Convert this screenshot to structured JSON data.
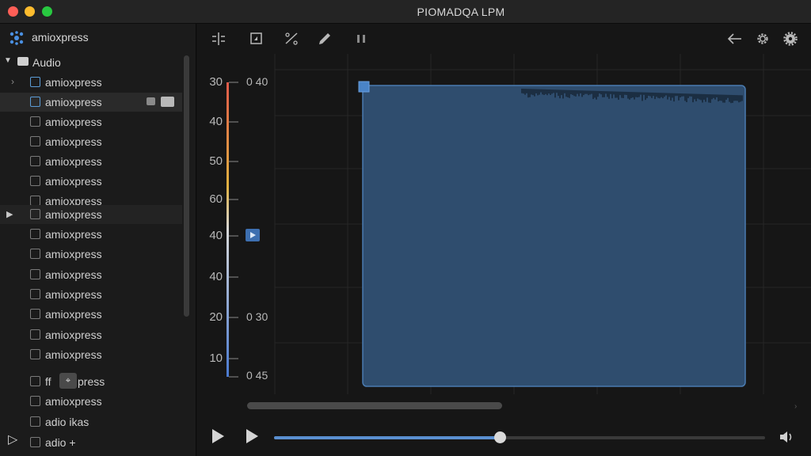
{
  "window": {
    "title": "PIOMADQA LPM"
  },
  "sidebar": {
    "app_name": "amioxpress",
    "group_label": "Audio",
    "items": [
      {
        "label": "amioxpress",
        "state": "expand"
      },
      {
        "label": "amioxpress",
        "state": "selected"
      },
      {
        "label": "amioxpress"
      },
      {
        "label": "amioxpress"
      },
      {
        "label": "amioxpress"
      },
      {
        "label": "amioxpress"
      },
      {
        "label": "amioxpress"
      },
      {
        "label": "amioxpress",
        "state": "playing"
      },
      {
        "label": "amioxpress"
      },
      {
        "label": "amioxpress"
      },
      {
        "label": "amioxpress"
      },
      {
        "label": "amioxpress"
      },
      {
        "label": "amioxpress"
      },
      {
        "label": "amioxpress"
      },
      {
        "label": "amioxpress"
      },
      {
        "label": "ff",
        "suffix": "press"
      },
      {
        "label": "amioxpress"
      },
      {
        "label": "adio ikas"
      },
      {
        "label": "adio +"
      }
    ]
  },
  "toolbar": {
    "icons": [
      "split-icon",
      "crop-icon",
      "cut-icon",
      "pencil-icon",
      "pause-icon",
      "back-arrow-icon",
      "gear-icon",
      "settings-icon"
    ]
  },
  "waveform": {
    "y_labels_left": [
      "30",
      "40",
      "50",
      "60",
      "40",
      "40",
      "20",
      "10"
    ],
    "y_labels_right": [
      "0 40",
      "0 30",
      "0 45"
    ],
    "selection_color": "#2f4d6e",
    "wave_color_left": "#c8a68a",
    "wave_color_right": "#a9c4de"
  },
  "transport": {
    "progress": 0.46
  }
}
